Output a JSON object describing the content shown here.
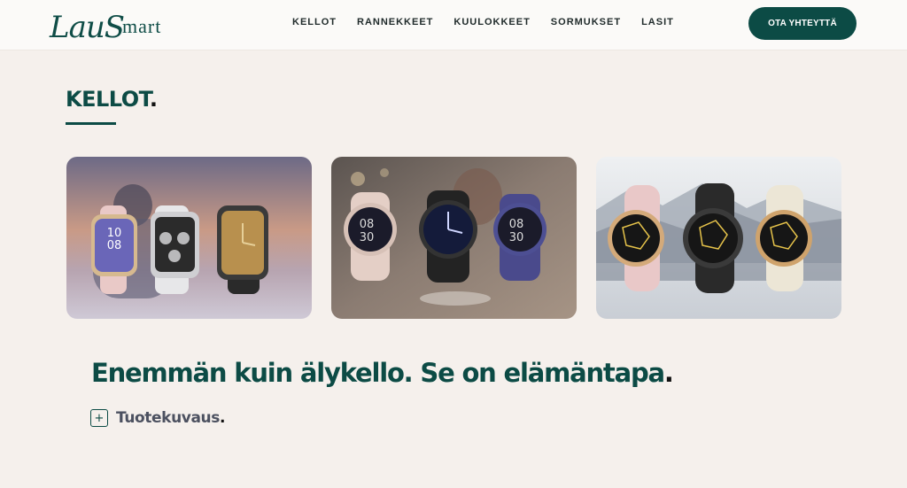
{
  "header": {
    "logo": {
      "script": "Lau",
      "serif_s": "S",
      "rest": "mart"
    },
    "nav": [
      {
        "label": "KELLOT"
      },
      {
        "label": "RANNEKKEET"
      },
      {
        "label": "KUULOKKEET"
      },
      {
        "label": "SORMUKSET"
      },
      {
        "label": "LASIT"
      }
    ],
    "cta_label": "OTA YHTEYTTÄ"
  },
  "section": {
    "title": "KELLOT",
    "title_dot": "."
  },
  "cards": [
    {
      "name": "square-smartwatches-sunset",
      "watch_time": "10 08"
    },
    {
      "name": "round-smartwatches-cafe",
      "watch_time": "08 30"
    },
    {
      "name": "round-smartwatches-mountains",
      "watch_time": ""
    }
  ],
  "tagline": {
    "text": "Enemmän kuin älykello. Se on elämäntapa",
    "dot": "."
  },
  "product_description": {
    "toggle_symbol": "+",
    "label": "Tuotekuvaus",
    "dot": "."
  },
  "colors": {
    "brand": "#0c4b45",
    "background": "#f5f0ec",
    "header": "#fbfaf8"
  }
}
